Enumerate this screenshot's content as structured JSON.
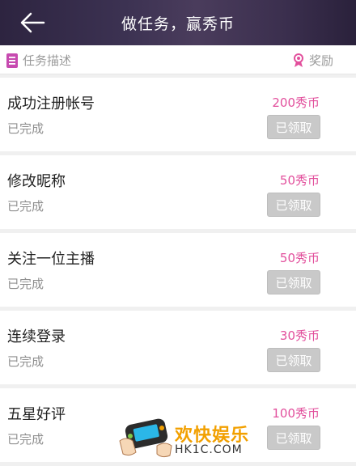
{
  "header": {
    "title": "做任务，赢秀币"
  },
  "columns": {
    "left_label": "任务描述",
    "right_label": "奖励"
  },
  "tasks": [
    {
      "name": "成功注册帐号",
      "status": "已完成",
      "reward": "200秀币",
      "button": "已领取"
    },
    {
      "name": "修改昵称",
      "status": "已完成",
      "reward": "50秀币",
      "button": "已领取"
    },
    {
      "name": "关注一位主播",
      "status": "已完成",
      "reward": "50秀币",
      "button": "已领取"
    },
    {
      "name": "连续登录",
      "status": "已完成",
      "reward": "30秀币",
      "button": "已领取"
    },
    {
      "name": "五星好评",
      "status": "已完成",
      "reward": "100秀币",
      "button": "已领取"
    }
  ],
  "watermark": {
    "brand": "欢快娱乐",
    "site": "HK1C.COM"
  },
  "colors": {
    "accent": "#e24f9c",
    "header_bg": "#3c3252",
    "button_disabled": "#c9c9c9"
  }
}
